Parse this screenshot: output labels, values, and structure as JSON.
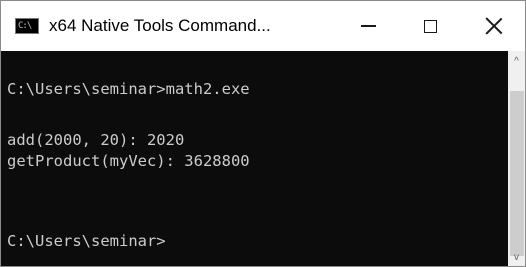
{
  "window": {
    "title": "x64 Native Tools Command...",
    "icon": "console-app-icon",
    "icon_glyph": "C:\\"
  },
  "controls": {
    "minimize_icon": "minimize-icon",
    "maximize_icon": "maximize-icon",
    "close_icon": "close-icon"
  },
  "console": {
    "background": "#0c0c0c",
    "foreground": "#cccccc",
    "lines": [
      "C:\\Users\\seminar>math2.exe",
      "",
      "add(2000, 20): 2020",
      "getProduct(myVec): 3628800",
      "",
      "",
      "C:\\Users\\seminar>"
    ]
  },
  "scrollbar": {
    "up_arrow": "^",
    "down_arrow": "v"
  }
}
